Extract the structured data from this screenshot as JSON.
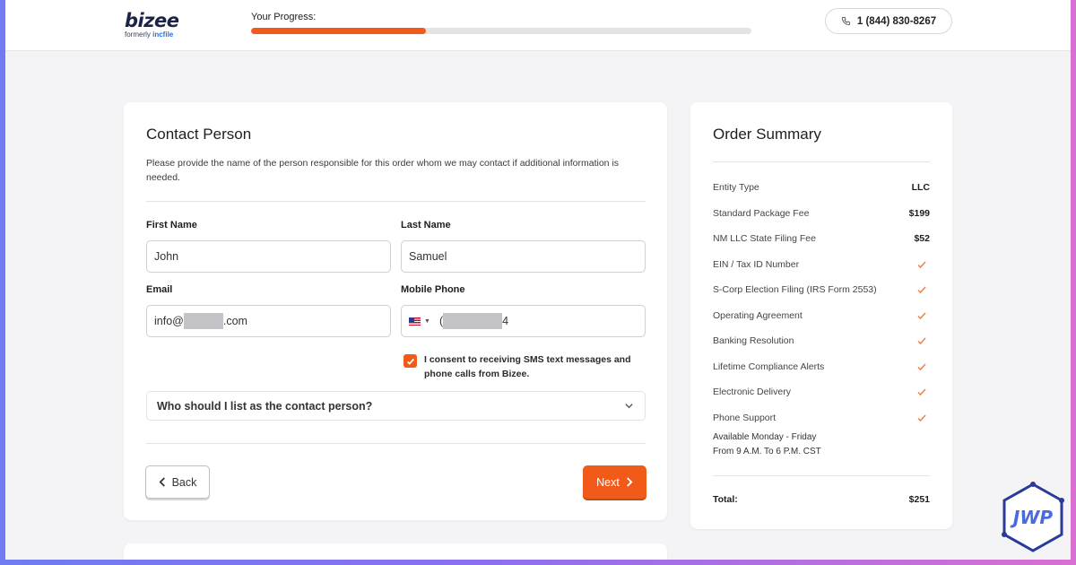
{
  "header": {
    "logo_text": "bizee",
    "logo_sub_prefix": "formerly ",
    "logo_sub_brand": "incfile",
    "progress_label": "Your Progress:",
    "progress_fraction": 0.35,
    "phone": "1 (844) 830-8267"
  },
  "contact": {
    "title": "Contact Person",
    "description": "Please provide the name of the person responsible for this order whom we may contact if additional information is needed.",
    "first_name_label": "First Name",
    "first_name_value": "John",
    "last_name_label": "Last Name",
    "last_name_value": "Samuel",
    "email_label": "Email",
    "email_prefix": "info@",
    "email_suffix": ".com",
    "phone_label": "Mobile Phone",
    "phone_prefix": "(",
    "phone_suffix": "4",
    "consent_text": "I consent to receiving SMS text messages and phone calls from Bizee.",
    "consent_checked": true,
    "accordion_label": "Who should I list as the contact person?",
    "back_label": "Back",
    "next_label": "Next"
  },
  "summary": {
    "title": "Order Summary",
    "rows": [
      {
        "label": "Entity Type",
        "value": "LLC"
      },
      {
        "label": "Standard Package Fee",
        "value": "$199"
      },
      {
        "label": "NM LLC State Filing Fee",
        "value": "$52"
      },
      {
        "label": "EIN / Tax ID Number",
        "value": "check"
      },
      {
        "label": "S-Corp Election Filing (IRS Form 2553)",
        "value": "check"
      },
      {
        "label": "Operating Agreement",
        "value": "check"
      },
      {
        "label": "Banking Resolution",
        "value": "check"
      },
      {
        "label": "Lifetime Compliance Alerts",
        "value": "check"
      },
      {
        "label": "Electronic Delivery",
        "value": "check"
      },
      {
        "label": "Phone Support",
        "value": "check"
      }
    ],
    "hours_line1": "Available Monday - Friday",
    "hours_line2": "From 9 A.M. To 6 P.M. CST",
    "total_label": "Total:",
    "total_value": "$251"
  },
  "watermark": {
    "text": "JWP"
  },
  "colors": {
    "accent": "#f15a19",
    "check": "#f0804a"
  }
}
